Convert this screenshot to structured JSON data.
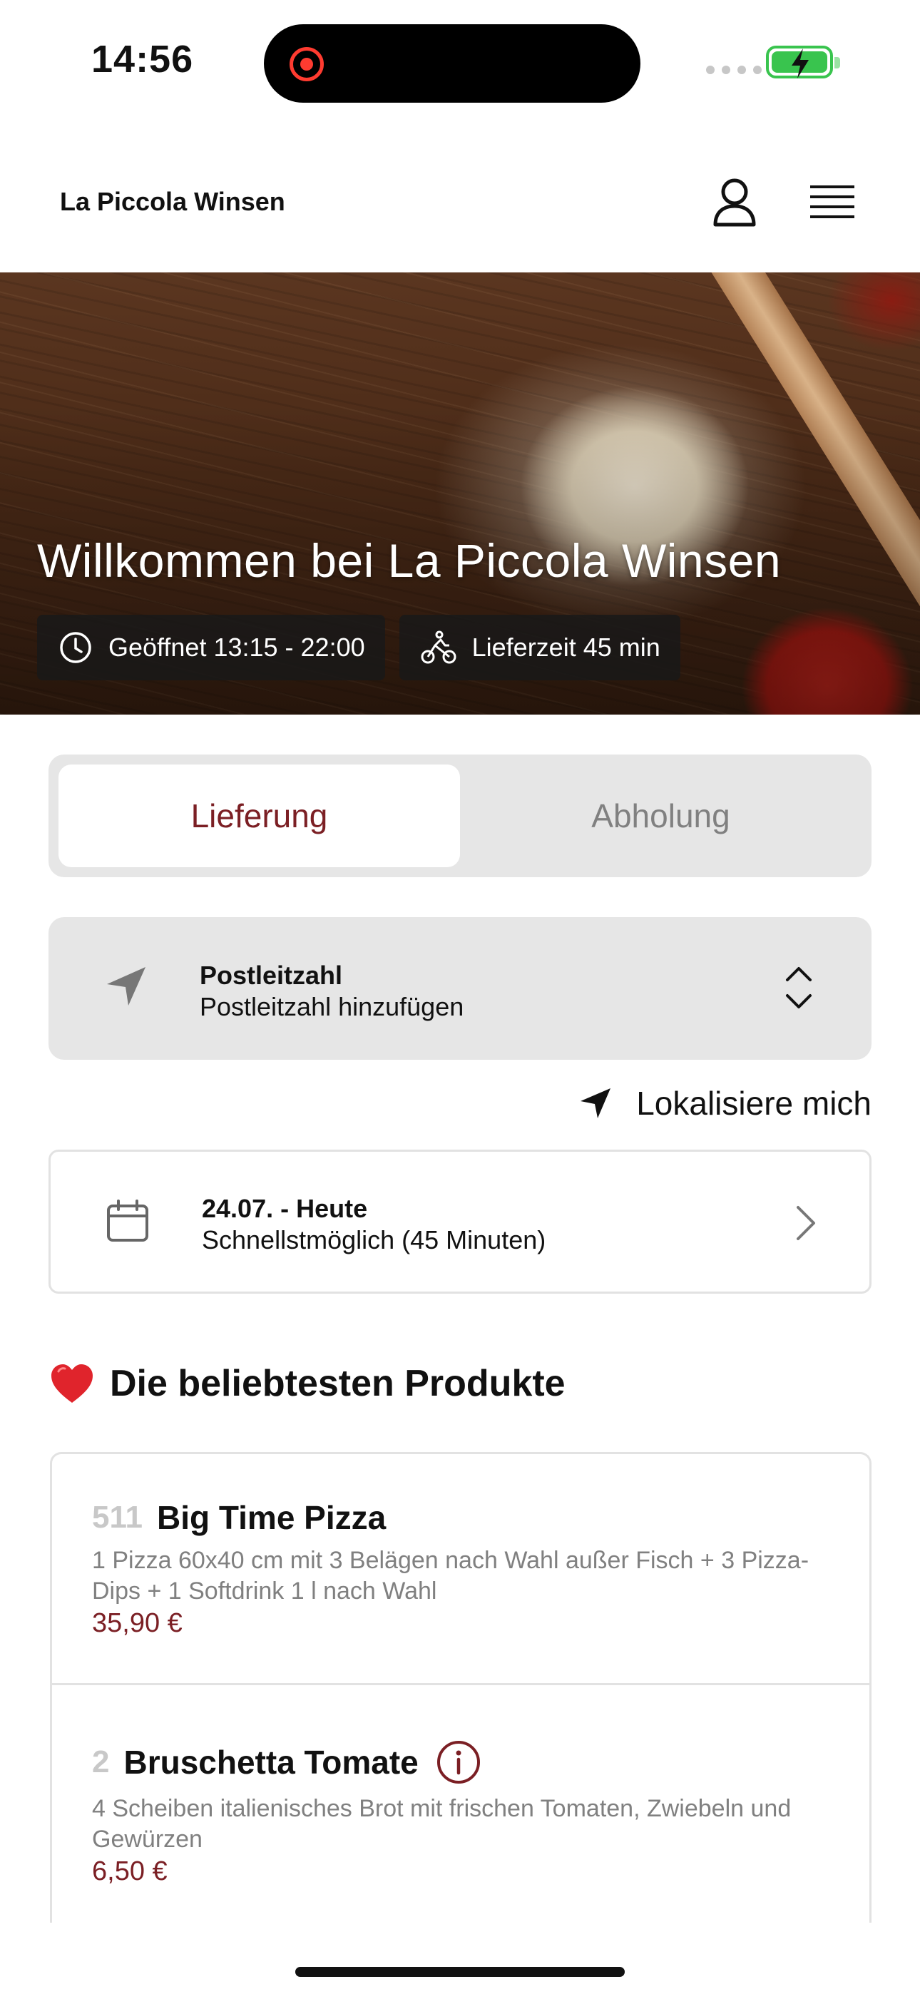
{
  "status_bar": {
    "time": "14:56"
  },
  "header": {
    "brand": "La Piccola Winsen"
  },
  "hero": {
    "title": "Willkommen bei La Piccola Winsen",
    "open_hours": "Geöffnet 13:15 - 22:00",
    "delivery_time": "Lieferzeit 45 min"
  },
  "mode_toggle": {
    "delivery": "Lieferung",
    "pickup": "Abholung",
    "selected": "Lieferung"
  },
  "postcode": {
    "label": "Postleitzahl",
    "value": "Postleitzahl hinzufügen"
  },
  "locate": {
    "label": "Lokalisiere mich"
  },
  "schedule": {
    "date": "24.07. - Heute",
    "time": "Schnellstmöglich (45 Minuten)"
  },
  "popular": {
    "title": "Die beliebtesten Produkte",
    "products": [
      {
        "number": "511",
        "name": "Big Time Pizza",
        "description": "1 Pizza 60x40 cm mit 3 Belägen nach Wahl außer Fisch + 3 Pizza-Dips + 1 Softdrink 1 l nach Wahl",
        "price": "35,90 €"
      },
      {
        "number": "2",
        "name": "Bruschetta Tomate",
        "description": "4 Scheiben italienisches Brot mit frischen Tomaten, Zwiebeln und Gewürzen",
        "price": "6,50 €"
      }
    ]
  },
  "colors": {
    "accent": "#7b1f24",
    "panel": "#e6e6e6",
    "muted": "#808080"
  },
  "icons": [
    "clock-icon",
    "bike-icon",
    "user-icon",
    "menu-icon",
    "navigation-arrow-icon",
    "chevron-up-down-icon",
    "calendar-icon",
    "chevron-right-icon",
    "heart-icon",
    "info-icon"
  ]
}
